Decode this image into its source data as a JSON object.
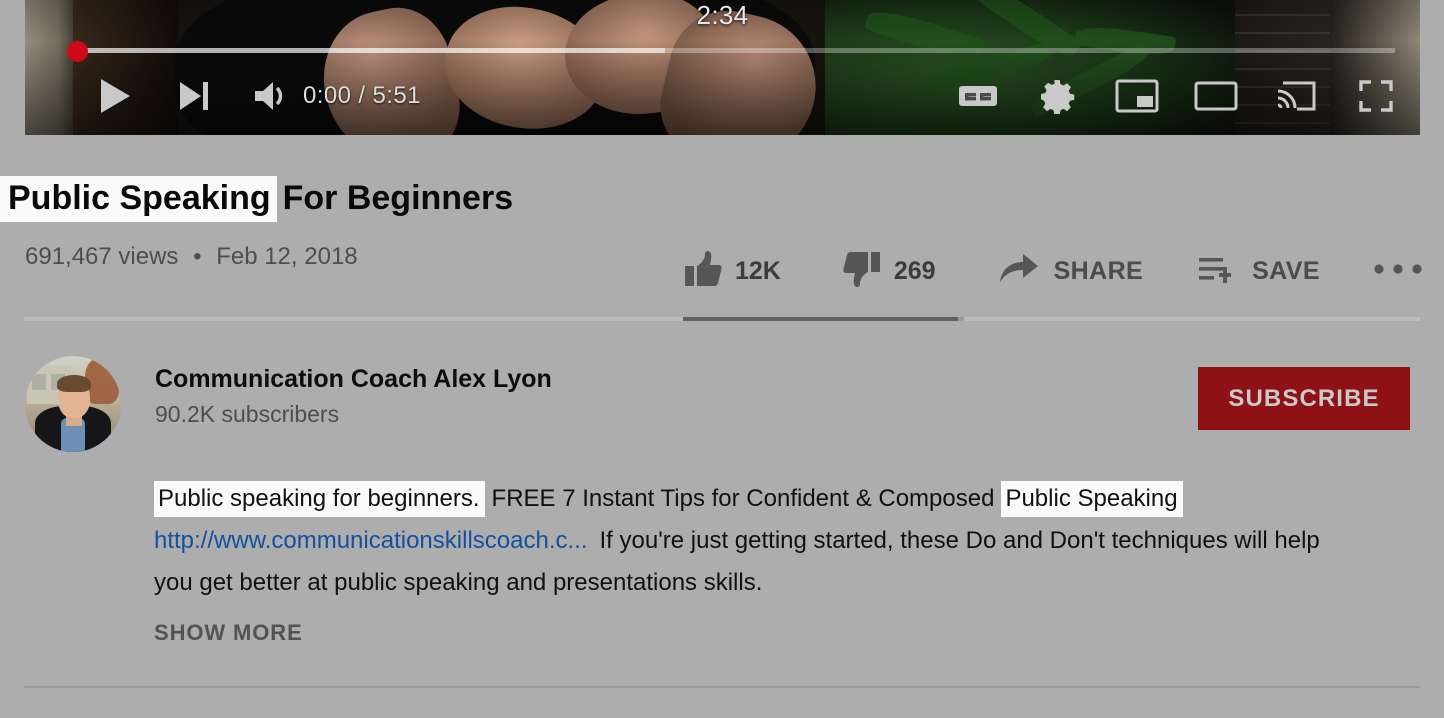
{
  "player": {
    "hover_time_tooltip": "2:34",
    "current_time": "0:00",
    "separator": "/",
    "duration": "5:51",
    "timecode": "0:00 / 5:51",
    "progress_percent": 0,
    "loaded_percent": 44,
    "controls": {
      "play": "play-button",
      "next": "next-video-button",
      "volume": "volume-button",
      "captions": "captions-cc-button",
      "settings": "settings-gear-button",
      "miniplayer": "miniplayer-button",
      "theater": "theater-mode-button",
      "cast": "cast-button",
      "fullscreen": "fullscreen-button"
    },
    "accent_color": "#cc0000"
  },
  "video": {
    "title_highlight": "Public Speaking",
    "title_rest": "For Beginners",
    "views": "691,467 views",
    "dot": "•",
    "published": "Feb 12, 2018"
  },
  "actions": {
    "like_count": "12K",
    "dislike_count": "269",
    "share_label": "SHARE",
    "save_label": "SAVE",
    "more_label": "•••"
  },
  "channel": {
    "name": "Communication Coach Alex Lyon",
    "subscribers": "90.2K subscribers",
    "subscribe_label": "SUBSCRIBE",
    "subscribe_color": "#8e1116"
  },
  "description": {
    "highlight_1": "Public speaking for beginners.",
    "text_1": "FREE 7 Instant Tips for Confident & Composed",
    "highlight_2": "Public Speaking",
    "link": "http://www.communicationskillscoach.c...",
    "text_2": "If you're just getting started, these Do and Don't techniques will help you get better at public speaking and presentations skills.",
    "show_more_label": "SHOW MORE",
    "link_color": "#13509f",
    "highlight_color": "#fafafa"
  }
}
